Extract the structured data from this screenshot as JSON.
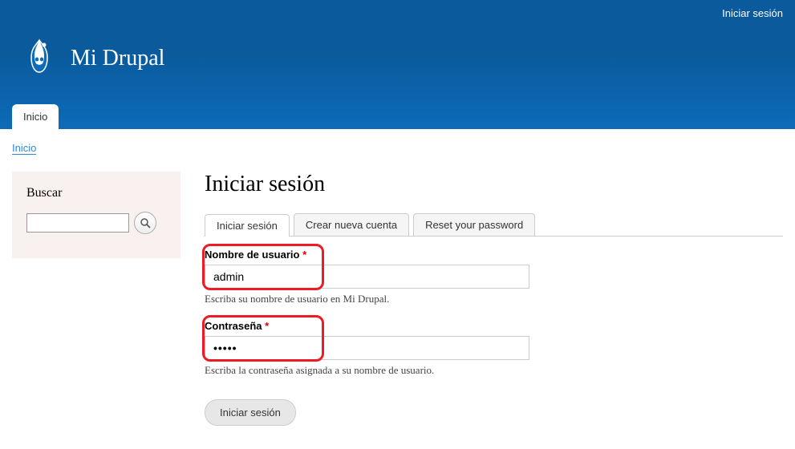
{
  "header": {
    "login_link": "Iniciar sesión",
    "site_name": "Mi Drupal"
  },
  "nav": {
    "home": "Inicio"
  },
  "breadcrumb": {
    "home": "Inicio"
  },
  "sidebar": {
    "search_title": "Buscar"
  },
  "main": {
    "title": "Iniciar sesión",
    "tabs": {
      "login": "Iniciar sesión",
      "register": "Crear nueva cuenta",
      "reset": "Reset your password"
    },
    "form": {
      "username_label": "Nombre de usuario",
      "username_value": "admin",
      "username_description": "Escriba su nombre de usuario en Mi Drupal.",
      "password_label": "Contraseña",
      "password_value": "•••••",
      "password_description": "Escriba la contraseña asignada a su nombre de usuario.",
      "submit": "Iniciar sesión"
    }
  }
}
